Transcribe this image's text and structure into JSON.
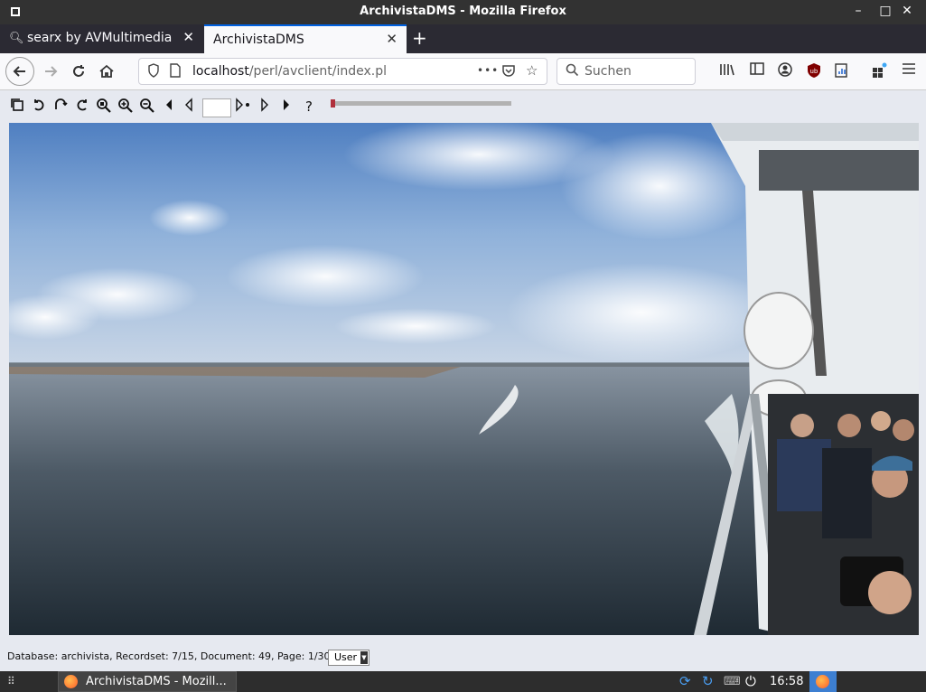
{
  "window": {
    "title": "ArchivistaDMS - Mozilla Firefox",
    "minimize_glyph": "–",
    "maximize_glyph": "□",
    "close_glyph": "✕"
  },
  "tabs": [
    {
      "label": "searx by AVMultimedia",
      "active": false,
      "icon": "magnifier-icon"
    },
    {
      "label": "ArchivistaDMS",
      "active": true,
      "icon": ""
    }
  ],
  "tab_glyphs": {
    "close": "✕",
    "new_tab": "+"
  },
  "nav": {
    "url_host": "localhost",
    "url_path": "/perl/avclient/index.pl",
    "search_placeholder": "Suchen",
    "page_actions_glyph": "•••"
  },
  "app_toolbar": {
    "help_glyph": "?",
    "page_number_value": "",
    "page_slider_position": 0.0
  },
  "status": {
    "text": "Database: archivista, Recordset: 7/15, Document: 49, Page: 1/30, Form:",
    "form_selected": "User"
  },
  "taskbar": {
    "task_label": "ArchivistaDMS - Mozill...",
    "clock": "16:58"
  },
  "colors": {
    "titlebar": "#323232",
    "tabstrip": "#2b2a33",
    "active_tab_accent": "#0061e0",
    "page_background": "#e6e9f0",
    "slider_knob": "#b0303c"
  }
}
